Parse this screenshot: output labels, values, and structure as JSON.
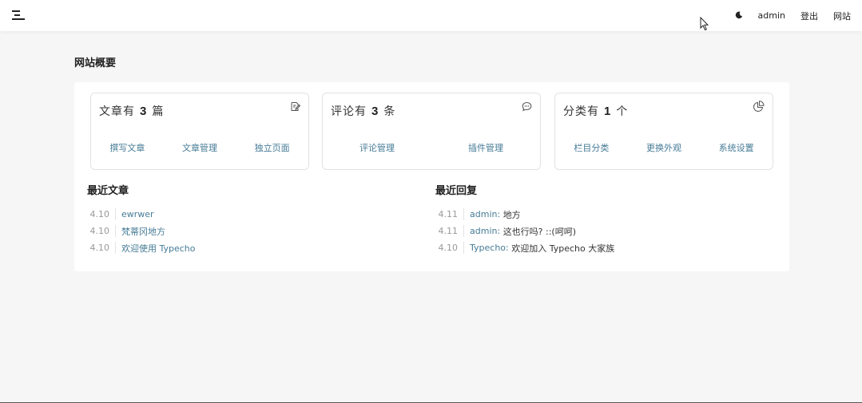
{
  "topbar": {
    "nav": [
      {
        "label": "admin"
      },
      {
        "label": "登出"
      },
      {
        "label": "网站"
      }
    ]
  },
  "page_title": "网站概要",
  "cards": [
    {
      "prefix": "文章有",
      "count": "3",
      "unit": "篇",
      "icon": "edit-icon",
      "links": [
        "撰写文章",
        "文章管理",
        "独立页面"
      ]
    },
    {
      "prefix": "评论有",
      "count": "3",
      "unit": "条",
      "icon": "comment-icon",
      "links": [
        "评论管理",
        "插件管理"
      ]
    },
    {
      "prefix": "分类有",
      "count": "1",
      "unit": "个",
      "icon": "pie-chart-icon",
      "links": [
        "栏目分类",
        "更换外观",
        "系统设置"
      ]
    }
  ],
  "recent_posts": {
    "title": "最近文章",
    "items": [
      {
        "date": "4.10",
        "title": "ewrwer"
      },
      {
        "date": "4.10",
        "title": "梵蒂冈地方"
      },
      {
        "date": "4.10",
        "title": "欢迎使用 Typecho"
      }
    ]
  },
  "recent_replies": {
    "title": "最近回复",
    "items": [
      {
        "date": "4.11",
        "author": "admin:",
        "text": "地方"
      },
      {
        "date": "4.11",
        "author": "admin:",
        "text": "这也行吗? ::(呵呵)"
      },
      {
        "date": "4.10",
        "author": "Typecho:",
        "text": "欢迎加入 Typecho 大家族"
      }
    ]
  },
  "colors": {
    "link": "#467b96",
    "background": "#f6f6f6",
    "panel": "#ffffff"
  }
}
